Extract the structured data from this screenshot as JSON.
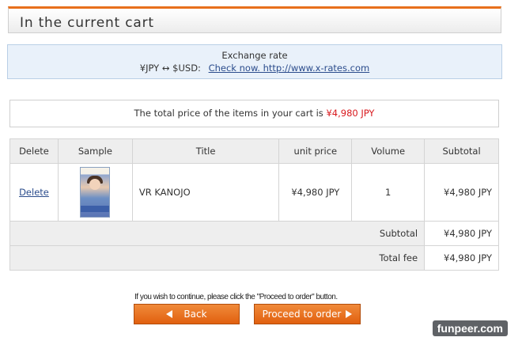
{
  "header": {
    "title": "In the current cart"
  },
  "exchange": {
    "title": "Exchange rate",
    "label": "¥JPY ↔ $USD:",
    "link_text": "Check now. http://www.x-rates.com"
  },
  "total": {
    "text": "The total price of the items in your cart is",
    "amount": "¥4,980 JPY"
  },
  "cart": {
    "columns": [
      "Delete",
      "Sample",
      "Title",
      "unit price",
      "Volume",
      "Subtotal"
    ],
    "items": [
      {
        "delete_label": "Delete",
        "title": "VR KANOJO",
        "unit_price": "¥4,980 JPY",
        "volume": "1",
        "subtotal": "¥4,980 JPY"
      }
    ],
    "subtotal_label": "Subtotal",
    "subtotal_value": "¥4,980 JPY",
    "total_fee_label": "Total fee",
    "total_fee_value": "¥4,980 JPY"
  },
  "footer": {
    "instruction": "If you wish to continue, please click the \"Proceed to order\" button.",
    "back_label": "Back",
    "proceed_label": "Proceed to order"
  },
  "watermark": {
    "text": "funpeer.com"
  },
  "colors": {
    "accent": "#e8701c",
    "price_red": "#d8191e",
    "link_blue": "#2b4c8c",
    "exchange_bg": "#e9f1fa"
  },
  "icons": {
    "back": "triangle-left-icon",
    "proceed": "triangle-right-icon"
  }
}
